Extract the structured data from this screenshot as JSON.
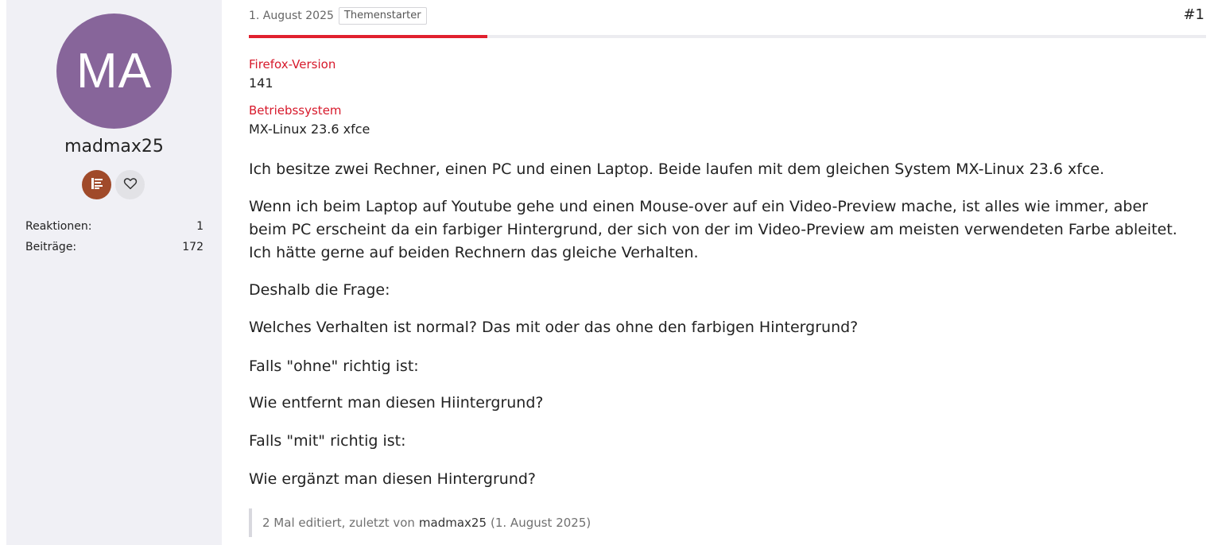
{
  "user": {
    "initials": "MA",
    "avatar_color": "#87659a",
    "name": "madmax25",
    "badges": [
      {
        "icon": "rank-list-icon",
        "color": "#a04a2a"
      },
      {
        "icon": "heart-icon",
        "color": "#e2e2e6"
      }
    ],
    "stats": [
      {
        "label": "Reaktionen:",
        "value": "1"
      },
      {
        "label": "Beiträge:",
        "value": "172"
      }
    ]
  },
  "post": {
    "date": "1. August 2025",
    "starter_label": "Themenstarter",
    "number": "#1",
    "accent_color": "#e1202e",
    "fields": [
      {
        "label": "Firefox-Version",
        "value": "141"
      },
      {
        "label": "Betriebssystem",
        "value": "MX-Linux 23.6 xfce"
      }
    ],
    "paragraphs": [
      "Ich besitze zwei Rechner, einen PC und einen Laptop. Beide laufen mit dem gleichen System MX-Linux 23.6 xfce.",
      "Wenn ich beim Laptop auf Youtube gehe und einen Mouse-over auf ein Video-Preview mache, ist alles wie immer, aber",
      "beim PC erscheint da ein farbiger Hintergrund, der sich von der im Video-Preview am meisten verwendeten Farbe ableitet.",
      "Ich hätte gerne auf beiden Rechnern das gleiche Verhalten.",
      "Deshalb die Frage:",
      "Welches Verhalten ist normal? Das mit oder das ohne den farbigen Hintergrund?",
      "Falls \"ohne\" richtig ist:",
      "Wie entfernt man diesen Hiintergrund?",
      "Falls \"mit\" richtig ist:",
      "Wie ergänzt man diesen Hintergrund?"
    ],
    "edit_note": {
      "prefix": "2 Mal editiert, zuletzt von",
      "user": "madmax25",
      "date": "(1. August 2025)"
    }
  }
}
